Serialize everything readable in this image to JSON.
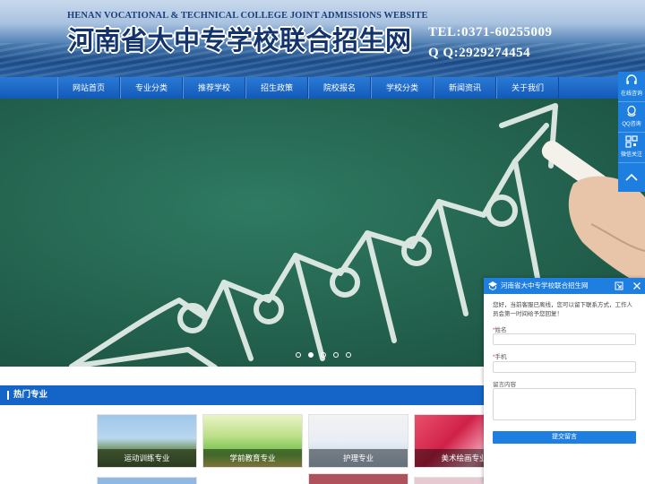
{
  "header": {
    "english_title": "HENAN VOCATIONAL & TECHNICAL COLLEGE JOINT ADMISSIONS WEBSITE",
    "chinese_title": "河南省大中专学校联合招生网",
    "tel": "TEL:0371-60255009",
    "qq": "Q Q:2929274454"
  },
  "nav": {
    "items": [
      {
        "label": "网站首页"
      },
      {
        "label": "专业分类"
      },
      {
        "label": "推荐学校"
      },
      {
        "label": "招生政策"
      },
      {
        "label": "院校报名"
      },
      {
        "label": "学校分类"
      },
      {
        "label": "新闻资讯"
      },
      {
        "label": "关于我们"
      }
    ]
  },
  "slider": {
    "dot_count": 5,
    "active_dot": 2
  },
  "hot": {
    "title": "热门专业",
    "items": [
      {
        "label": "运动训练专业"
      },
      {
        "label": "学前教育专业"
      },
      {
        "label": "护理专业"
      },
      {
        "label": "美术绘画专业"
      }
    ]
  },
  "sidebar": {
    "online": "在线咨询",
    "qq": "QQ咨询",
    "wechat": "微信关注"
  },
  "widget": {
    "title": "河南省大中专学校联合招生网",
    "notice": "您好，当前客服已离线，您可以留下联系方式，工作人员会第一时间给予您回复！",
    "name_label": "姓名",
    "phone_label": "手机",
    "message_label": "留言内容",
    "required_mark": "*",
    "submit": "提交留言"
  },
  "colors": {
    "nav_blue": "#1565c8",
    "accent_blue": "#1f7fe0",
    "chalkboard_green": "#23624e"
  }
}
